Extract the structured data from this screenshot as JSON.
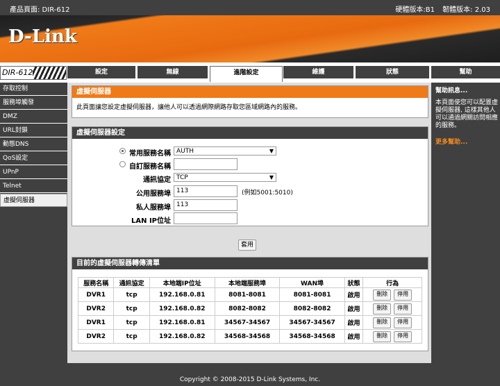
{
  "topbar": {
    "product": "產品頁面: DIR-612",
    "hw": "硬體版本:B1",
    "fw": "韌體版本: 2.03"
  },
  "brand": {
    "logo": "D-Link"
  },
  "model": "DIR-612",
  "tabs": [
    "設定",
    "無線",
    "進階設定",
    "維護",
    "狀態",
    "幫助"
  ],
  "sidebar": [
    "存取控制",
    "服務埠觸發",
    "DMZ",
    "URL封鎖",
    "動態DNS",
    "QoS設定",
    "UPnP",
    "Telnet",
    "虛擬伺服器"
  ],
  "intro": {
    "title": "虛擬伺服器",
    "text": "此頁面讓您設定虛擬伺服器，讓他人可以透過網際網路存取您區域網路內的服務。"
  },
  "settings": {
    "title": "虛擬伺服器設定",
    "common_label": "常用服務名稱",
    "common_value": "AUTH",
    "custom_label": "自訂服務名稱",
    "custom_value": "",
    "protocol_label": "通訊協定",
    "protocol_value": "TCP",
    "public_port_label": "公用服務埠",
    "public_port_value": "113",
    "public_port_hint": "(例如5001:5010)",
    "private_port_label": "私人服務埠",
    "private_port_value": "113",
    "lan_ip_label": "LAN IP位址",
    "lan_ip_value": ""
  },
  "apply_label": "套用",
  "list": {
    "title": "目前的虛擬伺服器轉傳清單",
    "headers": [
      "服務名稱",
      "通訊協定",
      "本地端IP位址",
      "本地端服務埠",
      "WAN埠",
      "狀態",
      "行為"
    ],
    "delete_label": "刪除",
    "disable_label": "停用",
    "rows": [
      [
        "DVR1",
        "tcp",
        "192.168.0.81",
        "8081-8081",
        "8081-8081",
        "啟用"
      ],
      [
        "DVR2",
        "tcp",
        "192.168.0.82",
        "8082-8082",
        "8082-8082",
        "啟用"
      ],
      [
        "DVR1",
        "tcp",
        "192.168.0.81",
        "34567-34567",
        "34567-34567",
        "啟用"
      ],
      [
        "DVR2",
        "tcp",
        "192.168.0.82",
        "34568-34568",
        "34568-34568",
        "啟用"
      ]
    ]
  },
  "help": {
    "title": "幫助訊息...",
    "text": "本頁面使您可以配置虛擬伺服器, 這樣其他人可以通過網關訪問相應的服務。",
    "more": "更多幫助..."
  },
  "footer": "Copyright © 2008-2015 D-Link Systems, Inc.",
  "colors": {
    "accent": "#f07a18",
    "dark": "#404040",
    "panel": "#dedede"
  }
}
